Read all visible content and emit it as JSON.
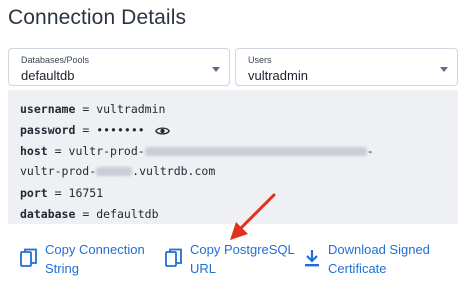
{
  "header": {
    "title": "Connection Details"
  },
  "databases_select": {
    "label": "Databases/Pools",
    "value": "defaultdb"
  },
  "users_select": {
    "label": "Users",
    "value": "vultradmin"
  },
  "connection": {
    "username_key": "username",
    "username_value": "vultradmin",
    "password_key": "password",
    "password_value": "•••••••",
    "host_key": "host",
    "host_value_prefix": "vultr-prod-",
    "host_line2_prefix": "vultr-prod-",
    "host_line2_suffix": ".vultrdb.com",
    "port_key": "port",
    "port_value": "16751",
    "database_key": "database",
    "database_value": "defaultdb",
    "equals": "="
  },
  "actions": {
    "copy_connection_line1": "Copy Connection",
    "copy_connection_line2": "String",
    "copy_postgres_line1": "Copy PostgreSQL",
    "copy_postgres_line2": "URL",
    "download_cert_line1": "Download Signed",
    "download_cert_line2": "Certificate"
  },
  "colors": {
    "link": "#1f6fd6",
    "arrow": "#e0321e",
    "code_bg": "#eef0f3"
  },
  "icons": [
    "chevron-down-icon",
    "eye-icon",
    "copy-icon",
    "download-icon",
    "arrow-annotation"
  ]
}
